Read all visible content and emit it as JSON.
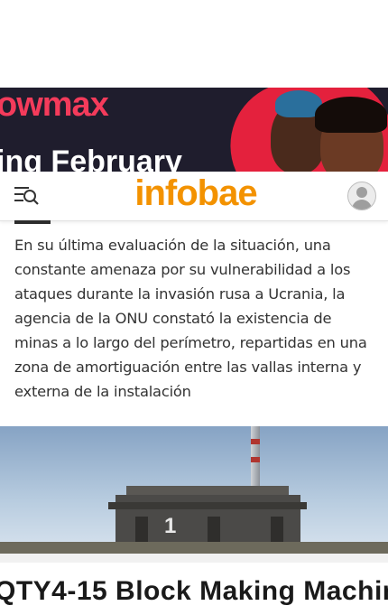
{
  "ad_banner": {
    "brand": "owmax",
    "tagline": "ing February"
  },
  "header": {
    "logo_text": "infobae"
  },
  "article": {
    "paragraph": "En su última evaluación de la situación, una constante amenaza por su vulnerabilidad a los ataques durante la invasión rusa a Ucrania, la agencia de la ONU constató la existencia de minas a lo largo del perímetro, repartidas en una zona de amortiguación entre las vallas interna y externa de la instalación"
  },
  "photo": {
    "building_number": "1"
  },
  "bottom_ad": {
    "title": "QTY4-15 Block Making Machin"
  },
  "colors": {
    "brand_orange": "#f39200",
    "ad_background": "#1f1d2d",
    "ad_accent": "#f43b5b"
  },
  "icons": [
    "menu-search-icon",
    "user-avatar-icon"
  ]
}
